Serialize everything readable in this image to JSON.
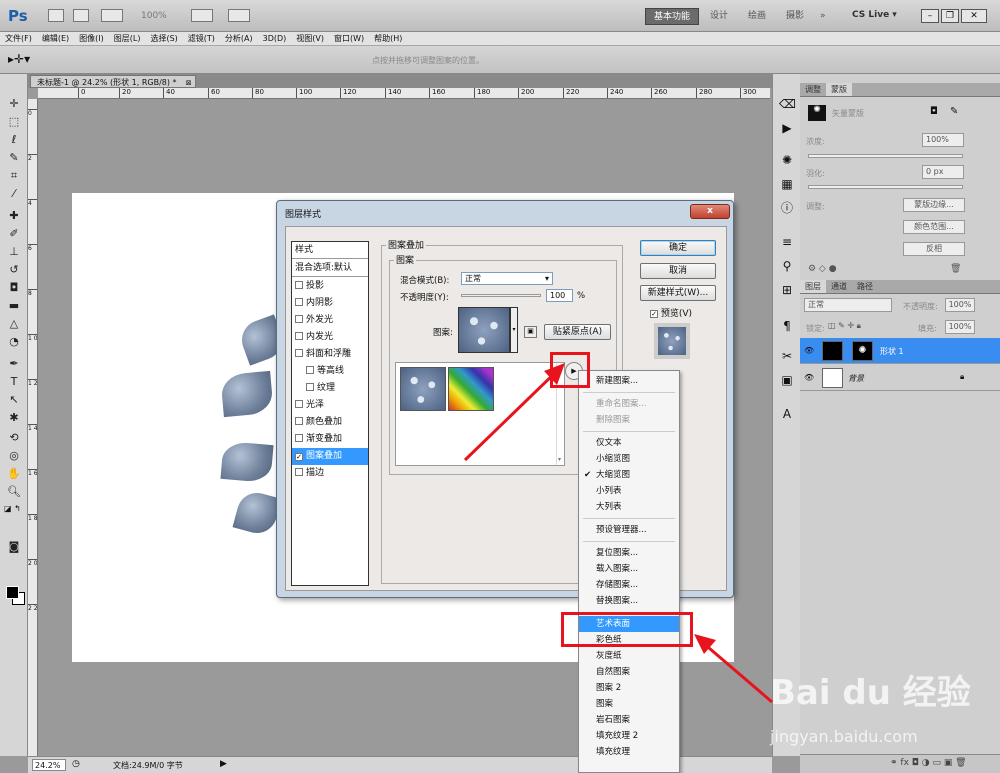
{
  "app": {
    "logo": "Ps",
    "zoom_display": "100%",
    "workspaces": [
      "基本功能",
      "设计",
      "绘画",
      "摄影"
    ],
    "more": "»",
    "cs_live": "CS Live ▾"
  },
  "menu": [
    "文件(F)",
    "编辑(E)",
    "图像(I)",
    "图层(L)",
    "选择(S)",
    "滤镜(T)",
    "分析(A)",
    "3D(D)",
    "视图(V)",
    "窗口(W)",
    "帮助(H)"
  ],
  "options": {
    "hint": "点按并拖移可调整图案的位置。"
  },
  "document": {
    "tab_title": "未标题-1 @ 24.2% (形状 1, RGB/8) *",
    "ruler_h": [
      "0",
      "20",
      "40",
      "60",
      "80",
      "100",
      "120",
      "140",
      "160",
      "180",
      "200",
      "220",
      "240",
      "260",
      "280",
      "300"
    ],
    "ruler_v": [
      "0",
      "2",
      "4",
      "6",
      "8",
      "1 0",
      "1 2",
      "1 4",
      "1 6",
      "1 8",
      "2 0",
      "2 2"
    ]
  },
  "status": {
    "zoom": "24.2%",
    "doc_size": "文档:24.9M/0 字节"
  },
  "masks_panel": {
    "tabs": [
      "调整",
      "蒙版"
    ],
    "mask_label": "矢量蒙版",
    "density_label": "浓度:",
    "density_value": "100%",
    "feather_label": "羽化:",
    "feather_value": "0 px",
    "refine_label": "调整:",
    "btn_edge": "蒙版边缘...",
    "btn_range": "颜色范围...",
    "btn_invert": "反相"
  },
  "layers_panel": {
    "tabs": [
      "图层",
      "通道",
      "路径"
    ],
    "blend": "正常",
    "opacity_label": "不透明度:",
    "opacity": "100%",
    "lock_label": "锁定:",
    "fill_label": "填充:",
    "fill": "100%",
    "layers": [
      {
        "name": "形状 1",
        "selected": true
      },
      {
        "name": "背景",
        "selected": false
      }
    ]
  },
  "dialog": {
    "title": "图层样式",
    "close": "x",
    "styles": [
      {
        "label": "样式",
        "type": "header"
      },
      {
        "label": "混合选项:默认",
        "type": "header"
      },
      {
        "label": "投影",
        "checked": false
      },
      {
        "label": "内阴影",
        "checked": false
      },
      {
        "label": "外发光",
        "checked": false
      },
      {
        "label": "内发光",
        "checked": false
      },
      {
        "label": "斜面和浮雕",
        "checked": false
      },
      {
        "label": "等高线",
        "checked": false,
        "indent": true
      },
      {
        "label": "纹理",
        "checked": false,
        "indent": true
      },
      {
        "label": "光泽",
        "checked": false
      },
      {
        "label": "颜色叠加",
        "checked": false
      },
      {
        "label": "渐变叠加",
        "checked": false
      },
      {
        "label": "图案叠加",
        "checked": true,
        "selected": true
      },
      {
        "label": "描边",
        "checked": false
      }
    ],
    "section_title": "图案叠加",
    "sub_title": "图案",
    "blend_label": "混合模式(B):",
    "blend_value": "正常",
    "opacity_label": "不透明度(Y):",
    "opacity_value": "100",
    "opacity_unit": "%",
    "pattern_label": "图案:",
    "snap_button": "贴紧原点(A)",
    "ok": "确定",
    "cancel": "取消",
    "new_style": "新建样式(W)...",
    "preview": "预览(V)"
  },
  "context_menu": {
    "items": [
      {
        "label": "新建图案...",
        "state": "normal"
      },
      {
        "sep": true
      },
      {
        "label": "重命名图案...",
        "state": "disabled"
      },
      {
        "label": "删除图案",
        "state": "disabled"
      },
      {
        "sep": true
      },
      {
        "label": "仅文本",
        "state": "normal"
      },
      {
        "label": "小缩览图",
        "state": "normal"
      },
      {
        "label": "大缩览图",
        "state": "checked"
      },
      {
        "label": "小列表",
        "state": "normal"
      },
      {
        "label": "大列表",
        "state": "normal"
      },
      {
        "sep": true
      },
      {
        "label": "预设管理器...",
        "state": "normal"
      },
      {
        "sep": true
      },
      {
        "label": "复位图案...",
        "state": "normal"
      },
      {
        "label": "载入图案...",
        "state": "normal"
      },
      {
        "label": "存储图案...",
        "state": "normal"
      },
      {
        "label": "替换图案...",
        "state": "normal"
      },
      {
        "sep": true
      },
      {
        "label": "艺术表面",
        "state": "highlight"
      },
      {
        "label": "彩色纸",
        "state": "normal"
      },
      {
        "label": "灰度纸",
        "state": "normal"
      },
      {
        "label": "自然图案",
        "state": "normal"
      },
      {
        "label": "图案 2",
        "state": "normal"
      },
      {
        "label": "图案",
        "state": "normal"
      },
      {
        "label": "岩石图案",
        "state": "normal"
      },
      {
        "label": "填充纹理 2",
        "state": "normal"
      },
      {
        "label": "填充纹理",
        "state": "normal"
      }
    ],
    "check_glyph": "✔"
  },
  "watermark": {
    "brand": "Bai du 经验",
    "url": "jingyan.baidu.com"
  },
  "colors": {
    "accent": "#3399ff",
    "annotation_red": "#e8141d"
  }
}
